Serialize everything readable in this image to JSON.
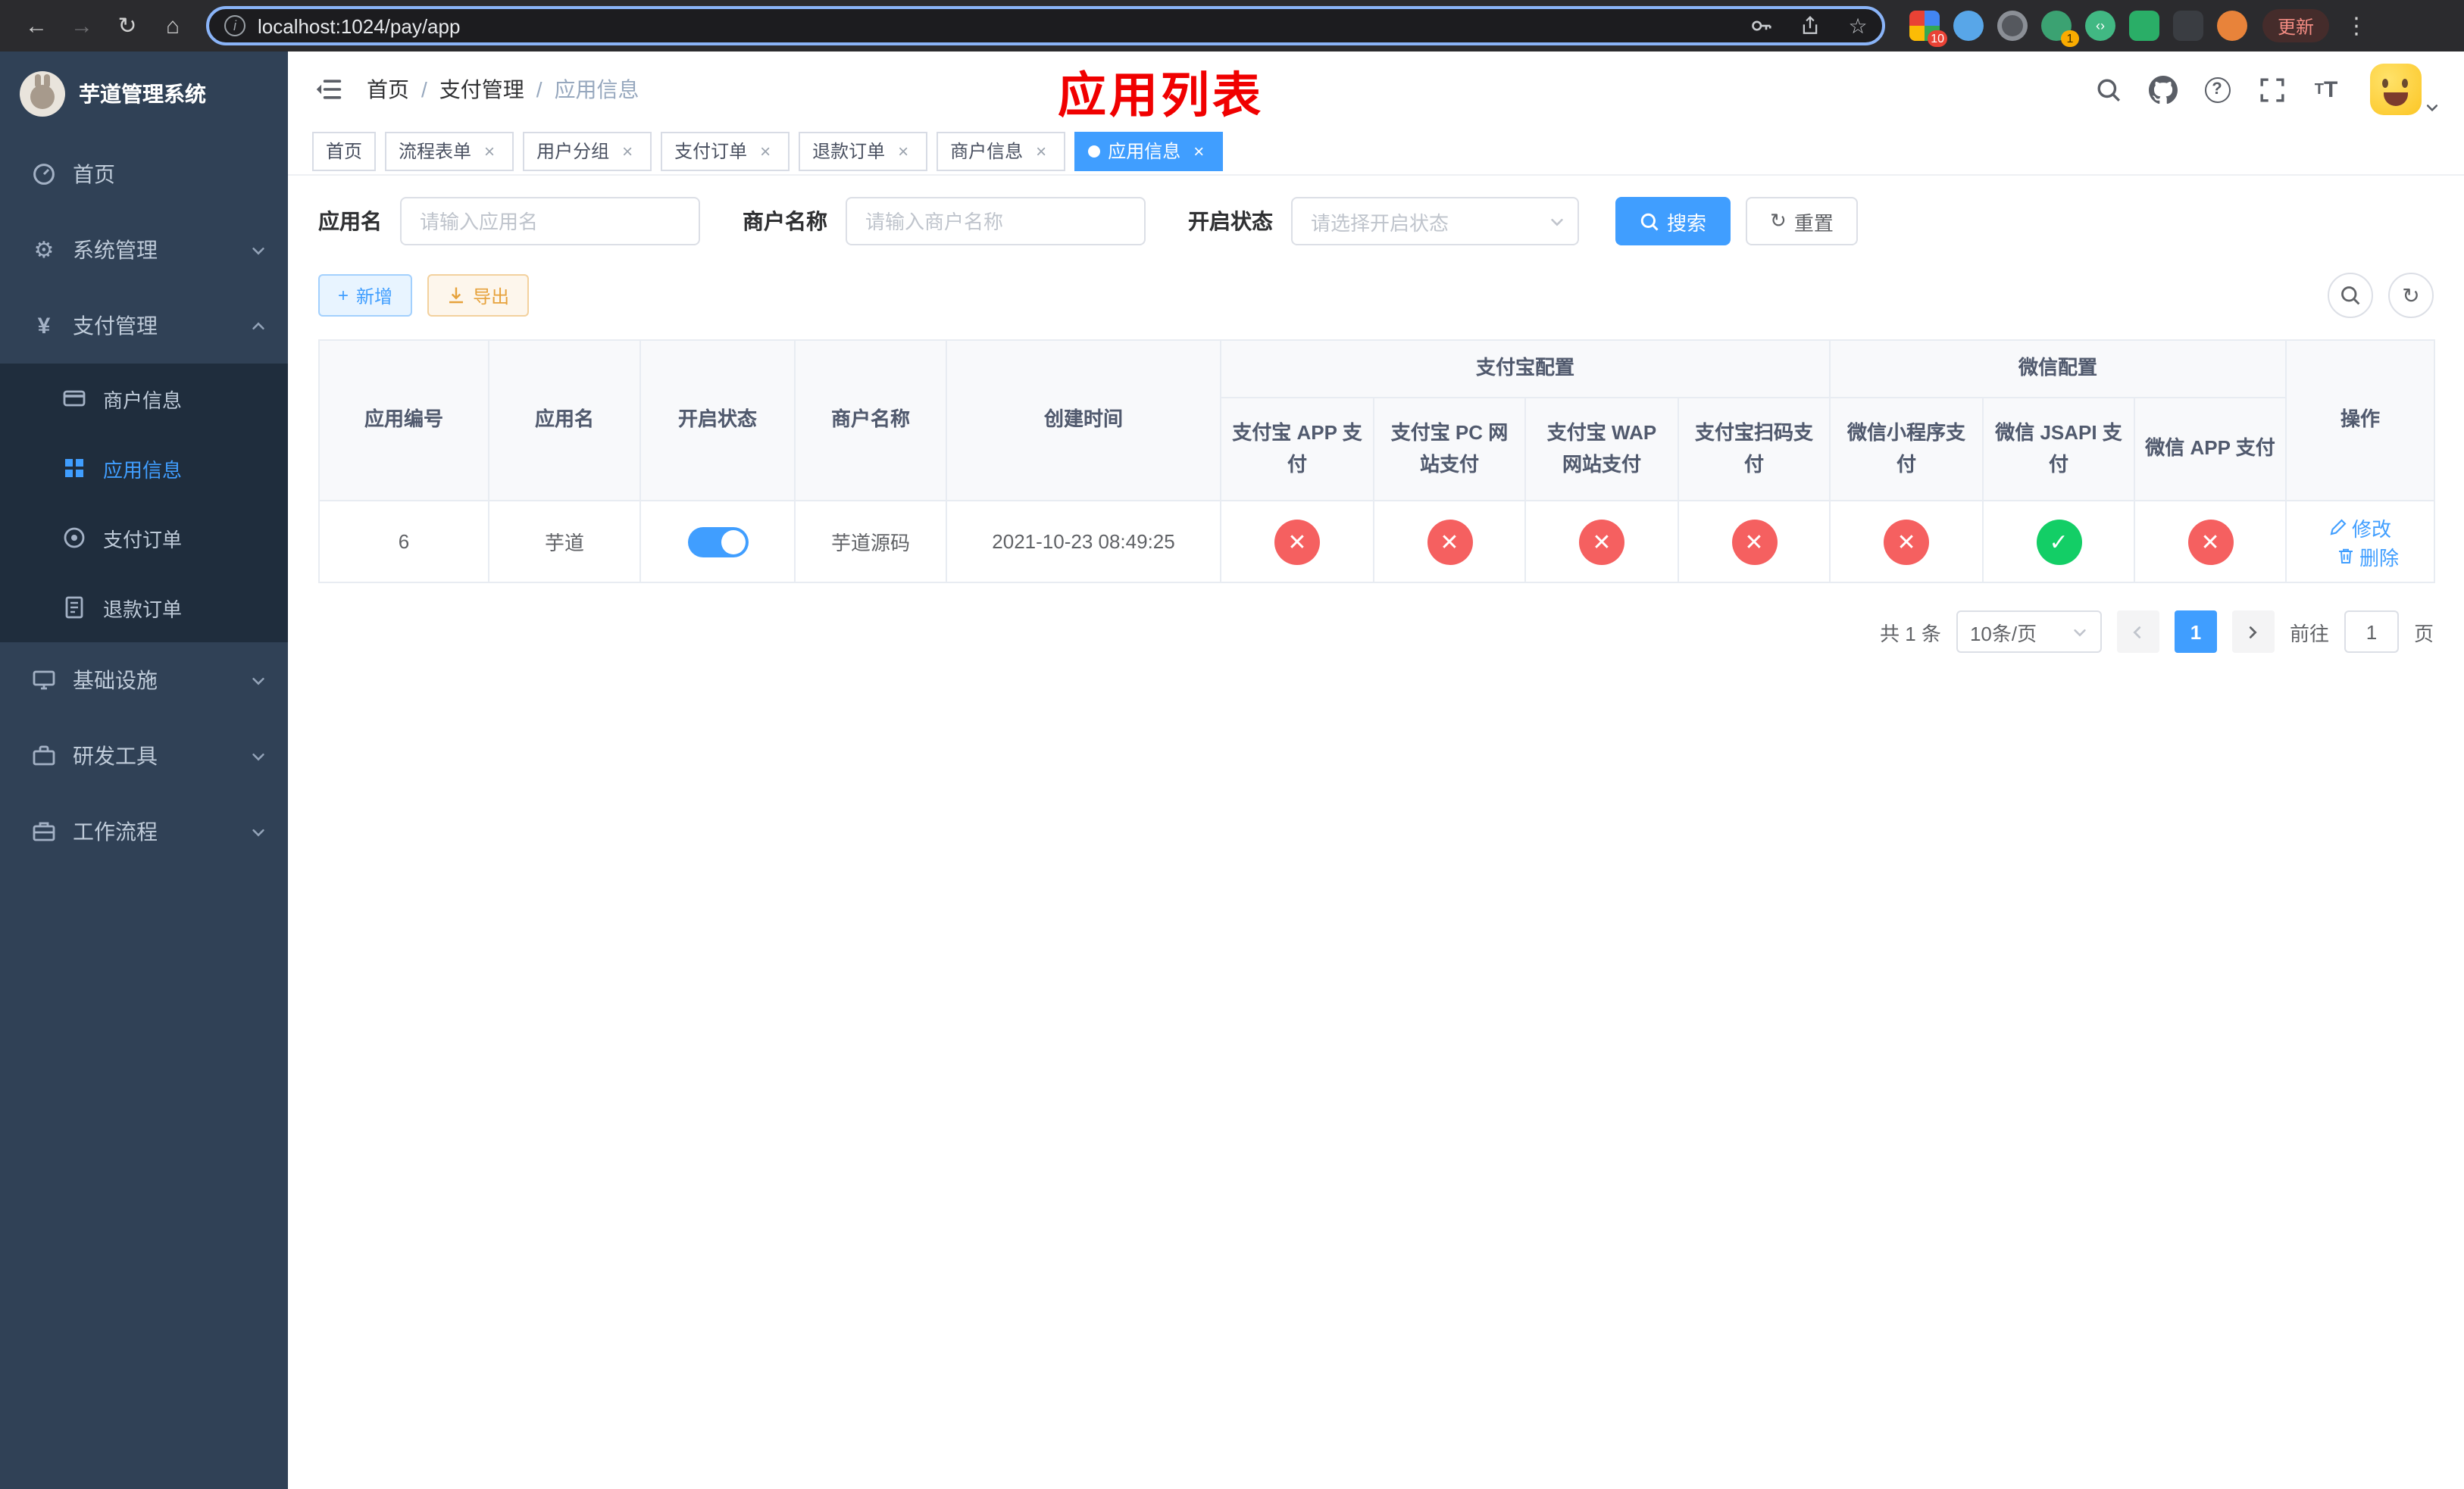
{
  "colors": {
    "primary": "#409eff",
    "success": "#13ce66",
    "danger": "#f56060",
    "sidebar_bg": "#304156",
    "annotation_red": "#f00000"
  },
  "browser": {
    "url": "localhost:1024/pay/app",
    "update_label": "更新",
    "badge_grid": "10",
    "badge_wechat": "1"
  },
  "annotation": "应用列表",
  "sidebar": {
    "title": "芋道管理系统",
    "items": [
      {
        "label": "首页"
      },
      {
        "label": "系统管理"
      },
      {
        "label": "支付管理"
      },
      {
        "label": "基础设施"
      },
      {
        "label": "研发工具"
      },
      {
        "label": "工作流程"
      }
    ],
    "submenu": [
      {
        "label": "商户信息"
      },
      {
        "label": "应用信息"
      },
      {
        "label": "支付订单"
      },
      {
        "label": "退款订单"
      }
    ]
  },
  "breadcrumb": {
    "separator": "/",
    "items": [
      "首页",
      "支付管理",
      "应用信息"
    ]
  },
  "tabs": [
    {
      "label": "首页"
    },
    {
      "label": "流程表单"
    },
    {
      "label": "用户分组"
    },
    {
      "label": "支付订单"
    },
    {
      "label": "退款订单"
    },
    {
      "label": "商户信息"
    },
    {
      "label": "应用信息"
    }
  ],
  "tab_close_glyph": "×",
  "filters": {
    "app_name_label": "应用名",
    "app_name_placeholder": "请输入应用名",
    "merchant_label": "商户名称",
    "merchant_placeholder": "请输入商户名称",
    "status_label": "开启状态",
    "status_placeholder": "请选择开启状态",
    "search_label": "搜索",
    "reset_label": "重置"
  },
  "toolbar": {
    "add_label": "新增",
    "export_label": "导出"
  },
  "table": {
    "groups": {
      "alipay": "支付宝配置",
      "wechat": "微信配置"
    },
    "columns": [
      "应用编号",
      "应用名",
      "开启状态",
      "商户名称",
      "创建时间",
      "支付宝 APP 支付",
      "支付宝 PC 网站支付",
      "支付宝 WAP 网站支付",
      "支付宝扫码支付",
      "微信小程序支付",
      "微信 JSAPI 支付",
      "微信 APP 支付",
      "操作"
    ],
    "row": {
      "id": "6",
      "name": "芋道",
      "enabled": true,
      "merchant": "芋道源码",
      "created": "2021-10-23 08:49:25",
      "pay_channels": [
        false,
        false,
        false,
        false,
        false,
        true,
        false
      ],
      "edit_label": "修改",
      "delete_label": "删除"
    }
  },
  "pagination": {
    "total_text": "共 1 条",
    "page_size_text": "10条/页",
    "current_page": "1",
    "goto_prefix": "前往",
    "goto_value": "1",
    "goto_suffix": "页"
  }
}
